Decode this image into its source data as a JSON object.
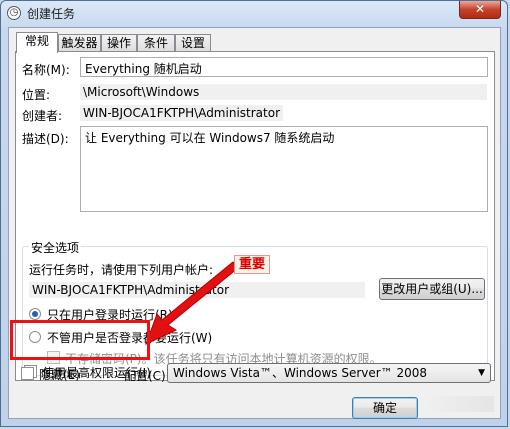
{
  "window": {
    "title": "创建任务",
    "close_glyph": "✕"
  },
  "tabs": [
    {
      "label": "常规",
      "active": true
    },
    {
      "label": "触发器",
      "active": false
    },
    {
      "label": "操作",
      "active": false
    },
    {
      "label": "条件",
      "active": false
    },
    {
      "label": "设置",
      "active": false
    }
  ],
  "general": {
    "name_label": "名称(M):",
    "name_value": "Everything 随机启动",
    "location_label": "位置:",
    "location_value": "\\Microsoft\\Windows",
    "author_label": "创建者:",
    "author_value": "WIN-BJOCA1FKTPH\\Administrator",
    "description_label": "描述(D):",
    "description_value": "让 Everything 可以在 Windows7 随系统启动"
  },
  "security": {
    "group_title": "安全选项",
    "run_as_label": "运行任务时，请使用下列用户帐户:",
    "user_value": "WIN-BJOCA1FKTPH\\Administrator",
    "change_user_button": "更改用户或组(U)...",
    "radio_logged_on": "只在用户登录时运行(R)",
    "radio_whether_logged_on": "不管用户是否登录都要运行(W)",
    "radio_logged_on_selected": true,
    "no_store_password": "不存储密码(P)。该任务将只有访问本地计算机资源的权限。",
    "highest_privileges": "使用最高权限运行(I)",
    "highest_privileges_checked": true
  },
  "bottom": {
    "hidden_label": "隐藏(E)",
    "hidden_checked": false,
    "configure_label": "配置(C):",
    "configure_value": "Windows Vista™、Windows Server™ 2008",
    "ok_button": "确定"
  },
  "annotation": {
    "callout_text": "重要",
    "color": "#e11111"
  },
  "colors": {
    "accent": "#1f5fbf",
    "highlight": "#e11111"
  }
}
